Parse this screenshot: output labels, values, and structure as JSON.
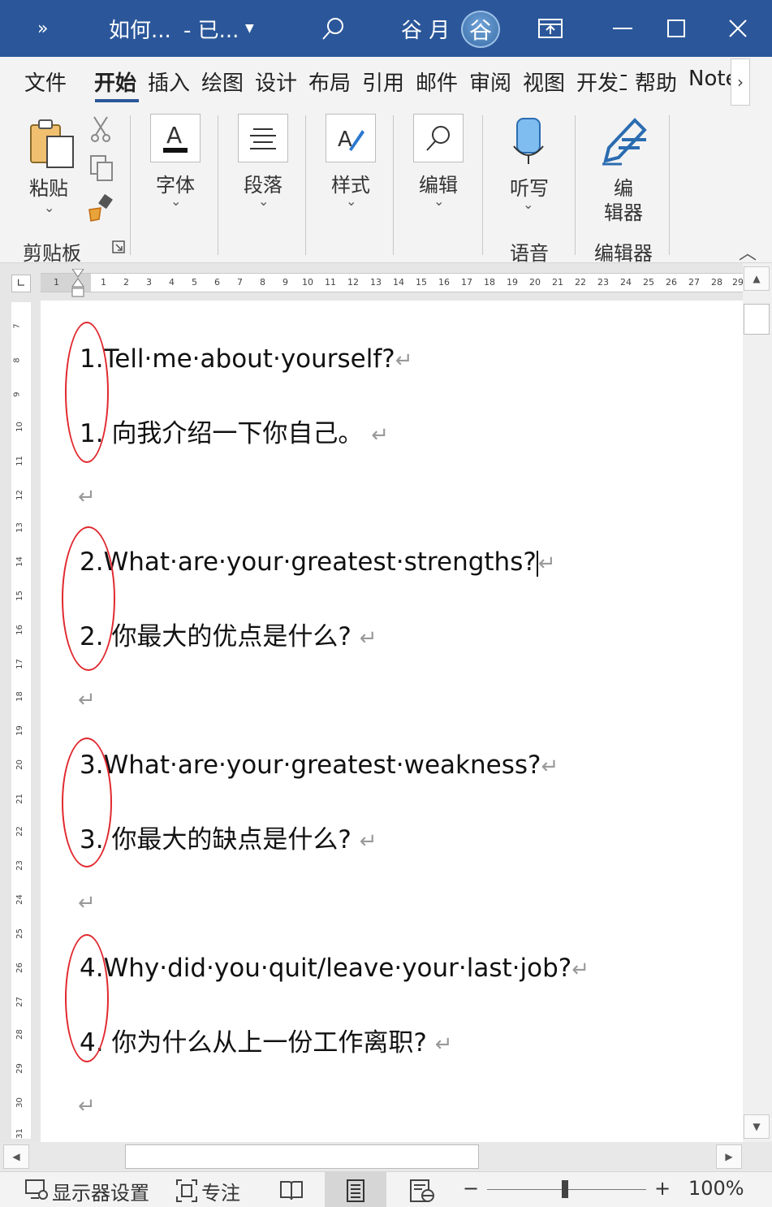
{
  "titlebar": {
    "overflow": "»",
    "doc_title": "如何...",
    "saved_state": "- 已...",
    "user_name": "谷 月",
    "avatar_initial": "谷",
    "accent": "#2b579a"
  },
  "tabs": [
    "文件",
    "开始",
    "插入",
    "绘图",
    "设计",
    "布局",
    "引用",
    "邮件",
    "审阅",
    "视图",
    "开发工",
    "帮助",
    "Note"
  ],
  "active_tab": "开始",
  "ribbon": {
    "paste": "粘贴",
    "clipboard_group": "剪贴板",
    "font": "字体",
    "paragraph": "段落",
    "styles": "样式",
    "editing": "编辑",
    "dictate": "听写",
    "voice_group": "语音",
    "editor_1": "编",
    "editor_2": "辑器",
    "editor_group": "编辑器"
  },
  "document": {
    "items": [
      {
        "en_num": "1.",
        "en_text": "Tell·me·about·yourself?",
        "zh_num": "1.",
        "zh_text": "向我介绍一下你自己。"
      },
      {
        "en_num": "2.",
        "en_text": "What·are·your·greatest·strengths?",
        "zh_num": "2.",
        "zh_text": "你最大的优点是什么?"
      },
      {
        "en_num": "3.",
        "en_text": "What·are·your·greatest·weakness?",
        "zh_num": "3.",
        "zh_text": "你最大的缺点是什么?"
      },
      {
        "en_num": "4.",
        "en_text": "Why·did·you·quit/leave·your·last·job?",
        "zh_num": "4.",
        "zh_text": "你为什么从上一份工作离职?"
      }
    ],
    "paragraph_mark": "↵",
    "annotation_color": "#e0282e"
  },
  "statusbar": {
    "display_settings": "显示器设置",
    "focus": "专注",
    "zoom_minus": "−",
    "zoom_plus": "+",
    "zoom": "100%"
  }
}
